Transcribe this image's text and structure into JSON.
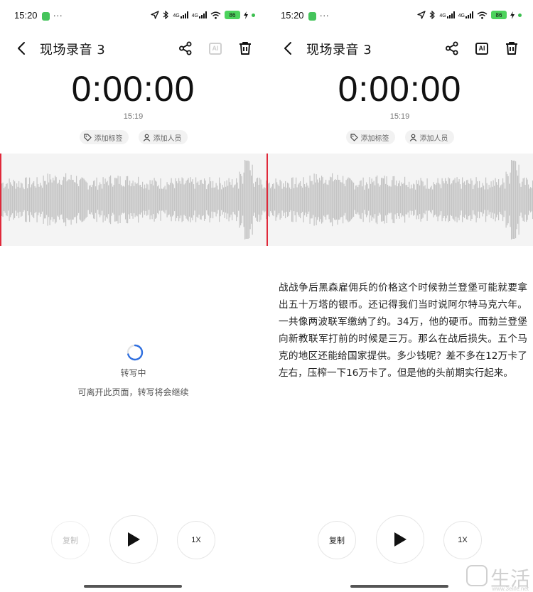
{
  "status_bar": {
    "time": "15:20",
    "network_labels": [
      "4G",
      "4G"
    ],
    "battery": "86",
    "icons": [
      "app-badge-icon",
      "more-icon",
      "location-icon",
      "bluetooth-icon",
      "signal-icon",
      "wifi-icon",
      "battery-icon",
      "charging-icon"
    ]
  },
  "left": {
    "header": {
      "title": "现场录音 3",
      "ai_enabled": false
    },
    "timer": "0:00:00",
    "clock": "15:19",
    "chips": {
      "tag": "添加标签",
      "people": "添加人员"
    },
    "loading": {
      "text": "转写中",
      "hint": "可离开此页面，转写将会继续"
    },
    "controls": {
      "copy": "复制",
      "speed": "1X",
      "copy_enabled": false
    }
  },
  "right": {
    "header": {
      "title": "现场录音 3",
      "ai_enabled": true
    },
    "timer": "0:00:00",
    "clock": "15:19",
    "chips": {
      "tag": "添加标签",
      "people": "添加人员"
    },
    "transcript": "战战争后黑森雇佣兵的价格这个时候勃兰登堡可能就要拿出五十万塔的银币。还记得我们当时说阿尔特马克六年。一共像两波联军缴纳了约。34万，他的硬币。而勃兰登堡向新教联军打前的时候是三万。那么在战后损失。五个马克的地区还能给国家提供。多少钱呢？差不多在12万卡了左右，压榨一下16万卡了。但是他的头前期实行起来。",
    "controls": {
      "copy": "复制",
      "speed": "1X",
      "copy_enabled": true
    }
  },
  "colors": {
    "accent": "#2f6fe0",
    "playhead": "#e0293a",
    "waveform": "#c4c4c4"
  },
  "watermark": {
    "text": "生活",
    "url": "www.3elife.net"
  }
}
